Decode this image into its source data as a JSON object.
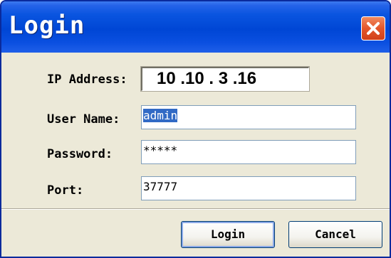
{
  "window": {
    "title": "Login"
  },
  "form": {
    "ip_label": "IP Address:",
    "ip_value": "10 .10 . 3 .16",
    "username_label": "User Name:",
    "username_value": "admin",
    "password_label": "Password:",
    "password_value": "*****",
    "port_label": "Port:",
    "port_value": "37777"
  },
  "buttons": {
    "login_label": "Login",
    "cancel_label": "Cancel"
  },
  "icons": {
    "close": "close-icon"
  },
  "colors": {
    "titlebar": "#0046d5",
    "close_button": "#e4562a",
    "dialog_bg": "#ece9d8",
    "selection": "#316ac5"
  }
}
